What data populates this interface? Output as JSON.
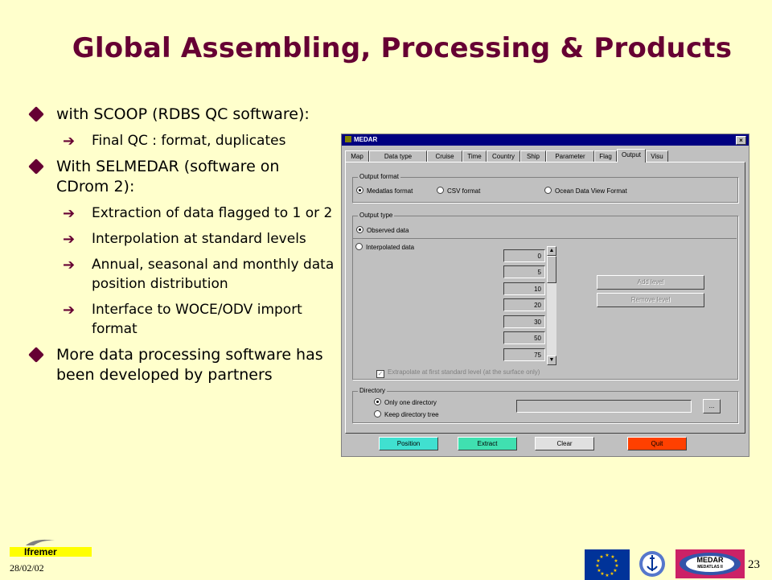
{
  "slide": {
    "title": "Global Assembling, Processing & Products",
    "date": "28/02/02",
    "page_number": "23",
    "accent_color": "#660033",
    "background_color": "#ffffcc"
  },
  "bullets": [
    {
      "level": 1,
      "text": "with SCOOP (RDBS QC software):"
    },
    {
      "level": 2,
      "text": "Final QC : format, duplicates"
    },
    {
      "level": 1,
      "text": "With SELMEDAR (software on CDrom 2):"
    },
    {
      "level": 2,
      "text": "Extraction of data flagged to 1 or 2"
    },
    {
      "level": 2,
      "text": "Interpolation at standard levels"
    },
    {
      "level": 2,
      "text": "Annual, seasonal and monthly data position distribution"
    },
    {
      "level": 2,
      "text": "Interface to WOCE/ODV import format"
    },
    {
      "level": 1,
      "text": "More data processing software has been developed by partners"
    }
  ],
  "dialog": {
    "title": "MEDAR",
    "close_glyph": "×",
    "tabs": [
      "Map",
      "Data type",
      "Cruise",
      "Time",
      "Country",
      "Ship",
      "Parameter",
      "Flag",
      "Output",
      "Visu"
    ],
    "active_tab": "Output",
    "output_format": {
      "label": "Output format",
      "options": [
        "Medatlas format",
        "CSV format",
        "Ocean Data View Format"
      ],
      "selected": "Medatlas format"
    },
    "output_type": {
      "label": "Output type",
      "options": [
        "Observed data",
        "Interpolated data"
      ],
      "selected": "Observed data"
    },
    "levels": [
      "0",
      "5",
      "10",
      "20",
      "30",
      "50",
      "75"
    ],
    "add_level_label": "Add level",
    "remove_level_label": "Remove level",
    "extrapolate_label": "Extrapolate at first standard level (at the surface only)",
    "extrapolate_checked": true,
    "directory": {
      "label": "Directory",
      "options": [
        "Only one directory",
        "Keep directory tree"
      ],
      "selected": "Only one directory",
      "browse_label": "..."
    },
    "buttons": [
      {
        "label": "Position",
        "color": "#40e0d0"
      },
      {
        "label": "Extract",
        "color": "#40e0b0"
      },
      {
        "label": "Clear",
        "color": "#e0e0e0"
      },
      {
        "label": "Quit",
        "color": "#ff4000"
      }
    ]
  },
  "footer": {
    "ifremer_text": "Ifremer",
    "medar_text": "MEDAR",
    "medatlas_text": "MEDATLAS II"
  }
}
